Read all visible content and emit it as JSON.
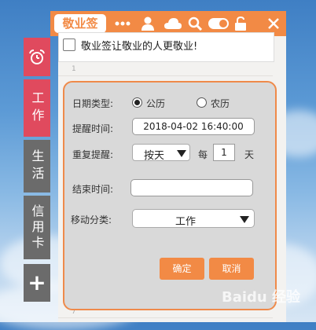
{
  "app": {
    "logo_text": "敬业签"
  },
  "titlebar": {
    "icons": [
      "more-icon",
      "user-icon",
      "cloud-icon",
      "search-icon",
      "toggle-icon",
      "lock-icon",
      "close-icon"
    ]
  },
  "note": {
    "text": "敬业签让敬业的人更敬业!",
    "line_numbers": [
      "1",
      "7"
    ]
  },
  "sidebar": {
    "items": [
      {
        "label": "",
        "icon": "alarm-clock-icon",
        "color": "#e04a5e"
      },
      {
        "label": "工作",
        "color": "#e04a5e"
      },
      {
        "label": "生活",
        "color": "#6b6b6b"
      },
      {
        "label": "信用卡",
        "color": "#6b6b6b"
      },
      {
        "label": "+",
        "icon": "plus-icon",
        "color": "#6b6b6b"
      }
    ]
  },
  "reminder_form": {
    "date_type_label": "日期类型:",
    "date_options": [
      {
        "label": "公历",
        "selected": true
      },
      {
        "label": "农历",
        "selected": false
      }
    ],
    "reminder_time_label": "提醒时间:",
    "reminder_time_value": "2018-04-02 16:40:00",
    "repeat_label": "重复提醒:",
    "repeat_value": "按天",
    "every_label": "每",
    "every_value": "1",
    "day_unit": "天",
    "end_time_label": "结束时间:",
    "end_time_value": "",
    "move_category_label": "移动分类:",
    "move_category_value": "工作",
    "confirm_label": "确定",
    "cancel_label": "取消"
  },
  "watermark": {
    "text": "Baidu 经验"
  },
  "colors": {
    "accent": "#f28a45",
    "red_tab": "#e04a5e",
    "gray_tab": "#6b6b6b"
  }
}
